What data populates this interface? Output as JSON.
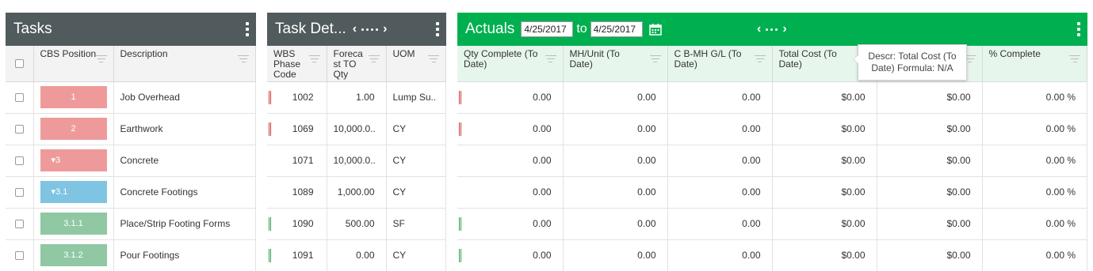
{
  "tasks_panel": {
    "title": "Tasks",
    "columns": [
      "CBS Position",
      "Description"
    ],
    "rows": [
      {
        "cbs": "1",
        "color": "pink",
        "description": "Job Overhead"
      },
      {
        "cbs": "2",
        "color": "pink",
        "description": "Earthwork"
      },
      {
        "cbs": "▾3",
        "color": "pink",
        "description": "Concrete"
      },
      {
        "cbs": "▾3.1",
        "color": "blue",
        "description": "Concrete Footings"
      },
      {
        "cbs": "3.1.1",
        "color": "green",
        "description": "Place/Strip Footing Forms"
      },
      {
        "cbs": "3.1.2",
        "color": "green",
        "description": "Pour Footings"
      }
    ]
  },
  "details_panel": {
    "title": "Task Det...",
    "columns": [
      "WBS Phase Code",
      "Foreca st TO Qty",
      "UOM"
    ],
    "rows": [
      {
        "flag": "red",
        "code": "1002",
        "qty": "1.00",
        "uom": "Lump Su.."
      },
      {
        "flag": "red",
        "code": "1069",
        "qty": "10,000.0..",
        "uom": "CY"
      },
      {
        "flag": "",
        "code": "1071",
        "qty": "10,000.0..",
        "uom": "CY"
      },
      {
        "flag": "",
        "code": "1089",
        "qty": "1,000.00",
        "uom": "CY"
      },
      {
        "flag": "green",
        "code": "1090",
        "qty": "500.00",
        "uom": "SF"
      },
      {
        "flag": "green",
        "code": "1091",
        "qty": "0.00",
        "uom": "CY"
      }
    ]
  },
  "actuals_panel": {
    "title": "Actuals",
    "date_from": "4/25/2017",
    "to_label": "to",
    "date_to": "4/25/2017",
    "columns": [
      "Qty Complete (To Date)",
      "MH/Unit (To Date)",
      "C B-MH G/L (To Date)",
      "Total Cost (To Date)",
      "",
      "% Complete"
    ],
    "rows": [
      {
        "flag": "red",
        "qty": "0.00",
        "mh": "0.00",
        "cb": "0.00",
        "cost": "$0.00",
        "col5": "$0.00",
        "pct": "0.00 %"
      },
      {
        "flag": "red",
        "qty": "0.00",
        "mh": "0.00",
        "cb": "0.00",
        "cost": "$0.00",
        "col5": "$0.00",
        "pct": "0.00 %"
      },
      {
        "flag": "",
        "qty": "0.00",
        "mh": "0.00",
        "cb": "0.00",
        "cost": "$0.00",
        "col5": "$0.00",
        "pct": "0.00 %"
      },
      {
        "flag": "",
        "qty": "0.00",
        "mh": "0.00",
        "cb": "0.00",
        "cost": "$0.00",
        "col5": "$0.00",
        "pct": "0.00 %"
      },
      {
        "flag": "green",
        "qty": "0.00",
        "mh": "0.00",
        "cb": "0.00",
        "cost": "$0.00",
        "col5": "$0.00",
        "pct": "0.00 %"
      },
      {
        "flag": "green",
        "qty": "0.00",
        "mh": "0.00",
        "cb": "0.00",
        "cost": "$0.00",
        "col5": "$0.00",
        "pct": "0.00 %"
      }
    ]
  },
  "tooltip": {
    "text": "Descr: Total Cost (To Date) Formula: N/A"
  },
  "icons": {
    "menu": "kebab-menu-icon",
    "prev": "chevron-left-icon",
    "next": "chevron-right-icon",
    "calendar": "calendar-icon",
    "filter": "filter-icon"
  },
  "colors": {
    "header_dark": "#515b5d",
    "header_green": "#00b050",
    "cbs_pink": "#ef9a9a",
    "cbs_blue": "#7fc4e3",
    "cbs_green": "#8fc8a3",
    "flag_red": "#d23a3a",
    "flag_green": "#2e9e53"
  }
}
